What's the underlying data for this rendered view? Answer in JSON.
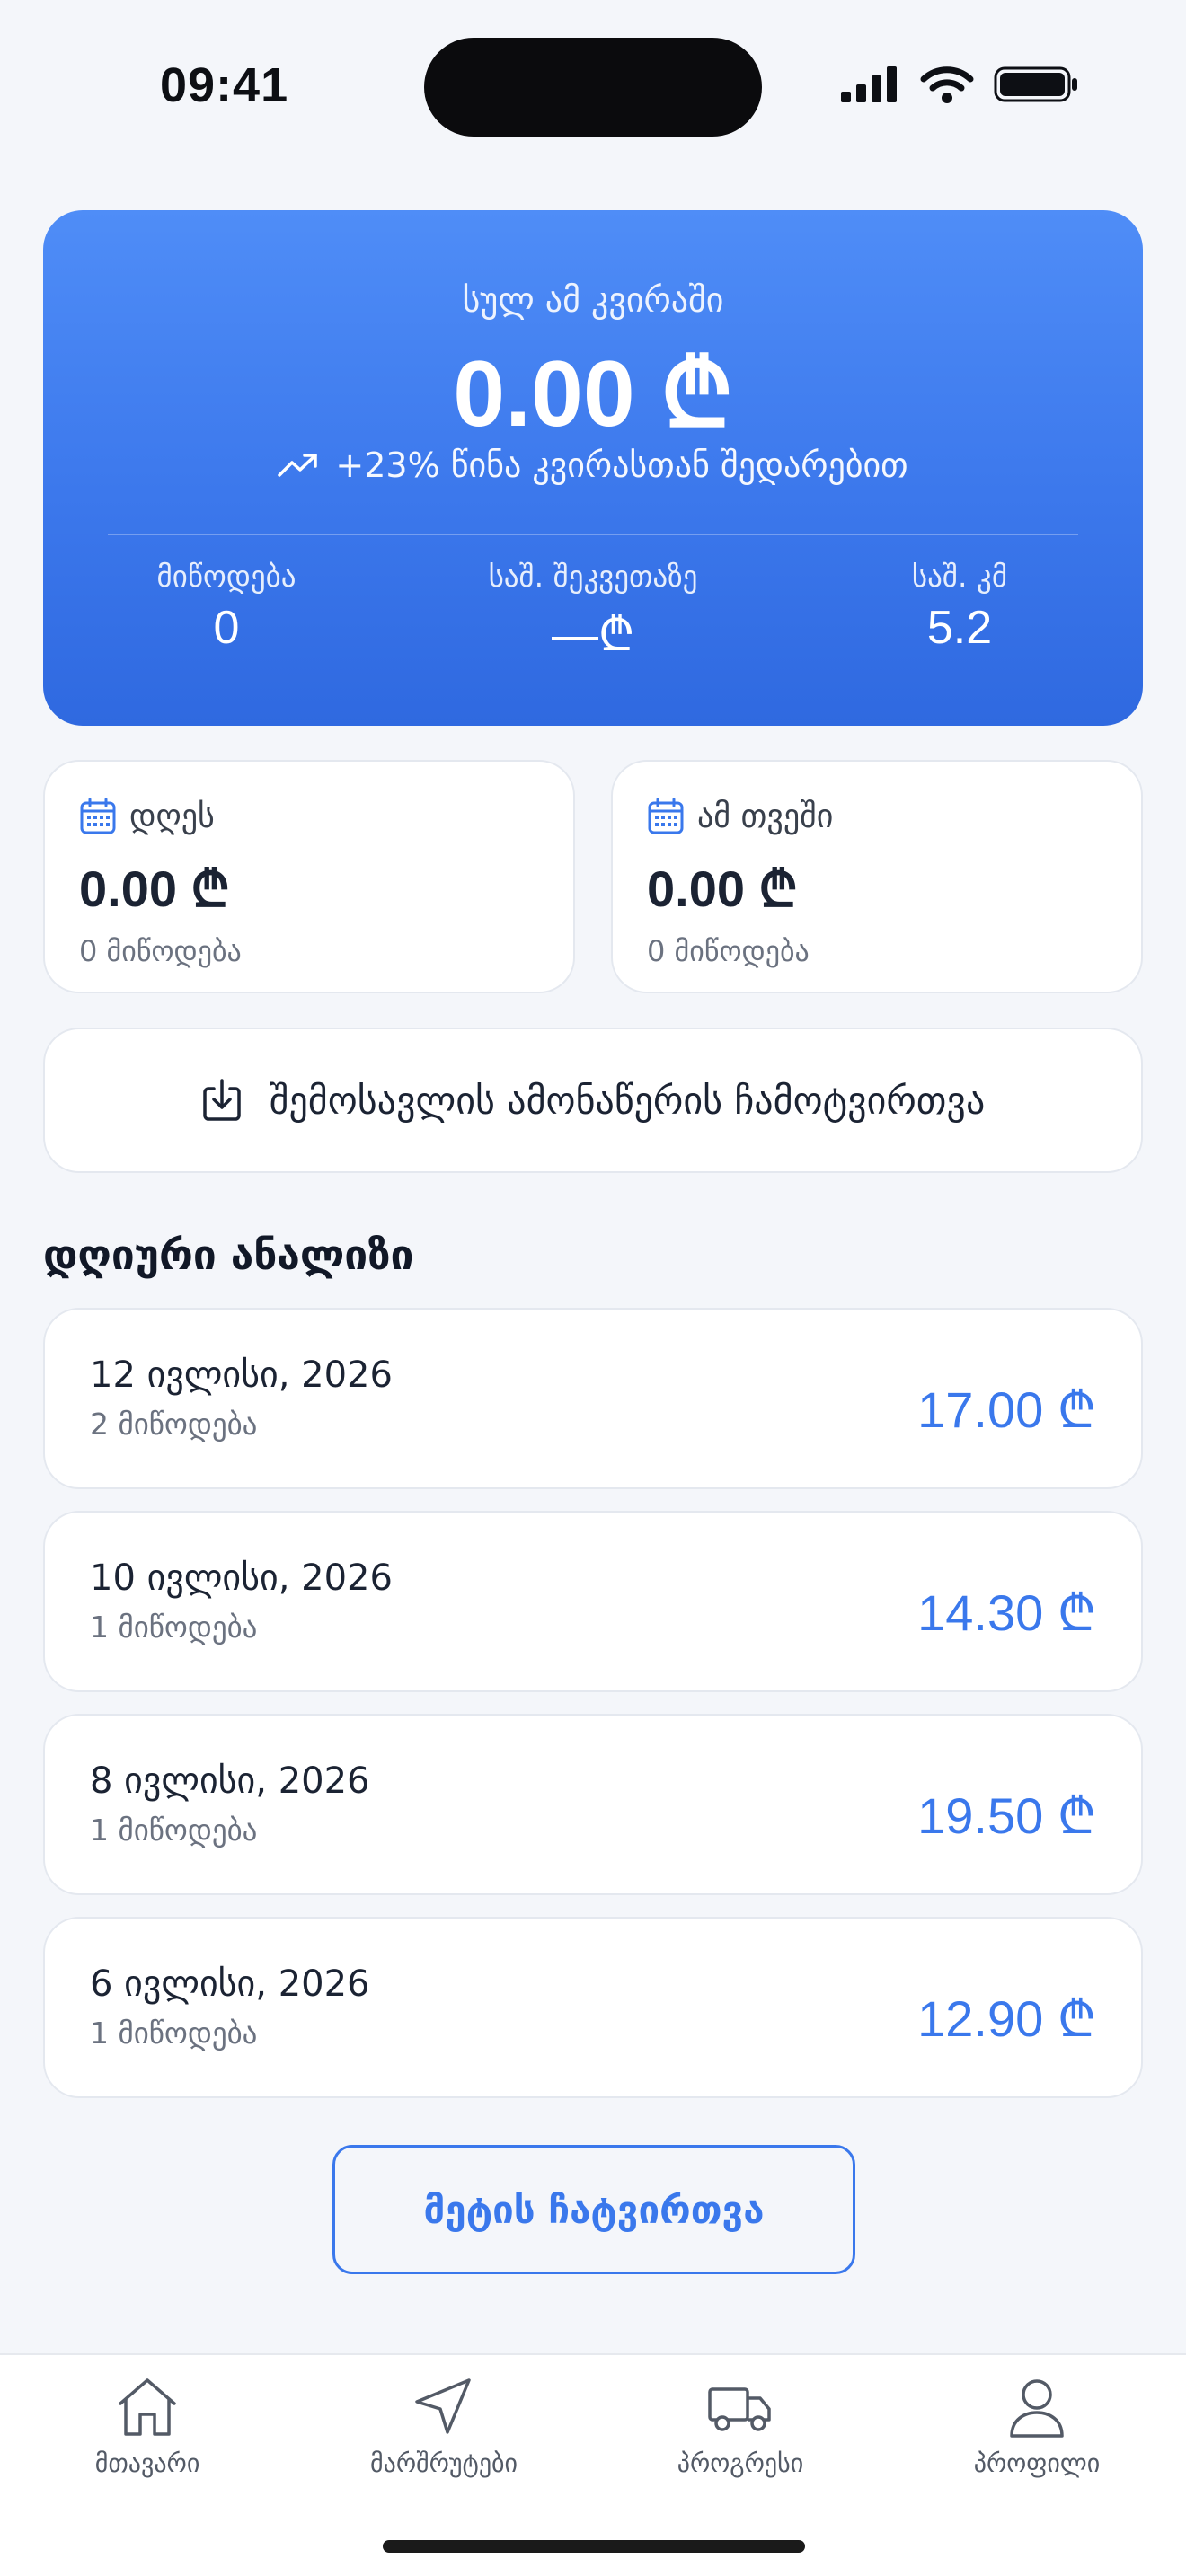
{
  "status": {
    "time": "09:41"
  },
  "hero": {
    "label": "სულ ამ კვირაში",
    "amount": "0.00 ₾",
    "trend": "+23% წინა კვირასთან შედარებით",
    "stats": [
      {
        "label": "მიწოდება",
        "value": "0"
      },
      {
        "label": "საშ. შეკვეთაზე",
        "value": "—₾"
      },
      {
        "label": "საშ. კმ",
        "value": "5.2"
      }
    ]
  },
  "today": {
    "label": "დღეს",
    "amount": "0.00 ₾",
    "sub": "0 მიწოდება",
    "icon": "calendar-icon"
  },
  "month": {
    "label": "ამ თვეში",
    "amount": "0.00 ₾",
    "sub": "0 მიწოდება",
    "icon": "calendar-icon"
  },
  "download": {
    "label": "შემოსავლის ამონაწერის ჩამოტვირთვა",
    "icon": "download-icon"
  },
  "daily": {
    "title": "დღიური ანალიზი",
    "items": [
      {
        "date": "12 ივლისი, 2026",
        "count": "2 მიწოდება",
        "amount": "17.00 ₾"
      },
      {
        "date": "10 ივლისი, 2026",
        "count": "1 მიწოდება",
        "amount": "14.30 ₾"
      },
      {
        "date": "8 ივლისი, 2026",
        "count": "1 მიწოდება",
        "amount": "19.50 ₾"
      },
      {
        "date": "6 ივლისი, 2026",
        "count": "1 მიწოდება",
        "amount": "12.90 ₾"
      }
    ]
  },
  "load_more": "მეტის ჩატვირთვა",
  "tabs": [
    {
      "label": "მთავარი",
      "icon": "home-icon"
    },
    {
      "label": "მარშრუტები",
      "icon": "navigation-icon"
    },
    {
      "label": "პროგრესი",
      "icon": "truck-icon"
    },
    {
      "label": "პროფილი",
      "icon": "user-icon"
    }
  ],
  "colors": {
    "accent": "#3A78EC",
    "hero_top": "#4F8DF7",
    "hero_bottom": "#2F69E0",
    "background": "#F4F6FA"
  }
}
